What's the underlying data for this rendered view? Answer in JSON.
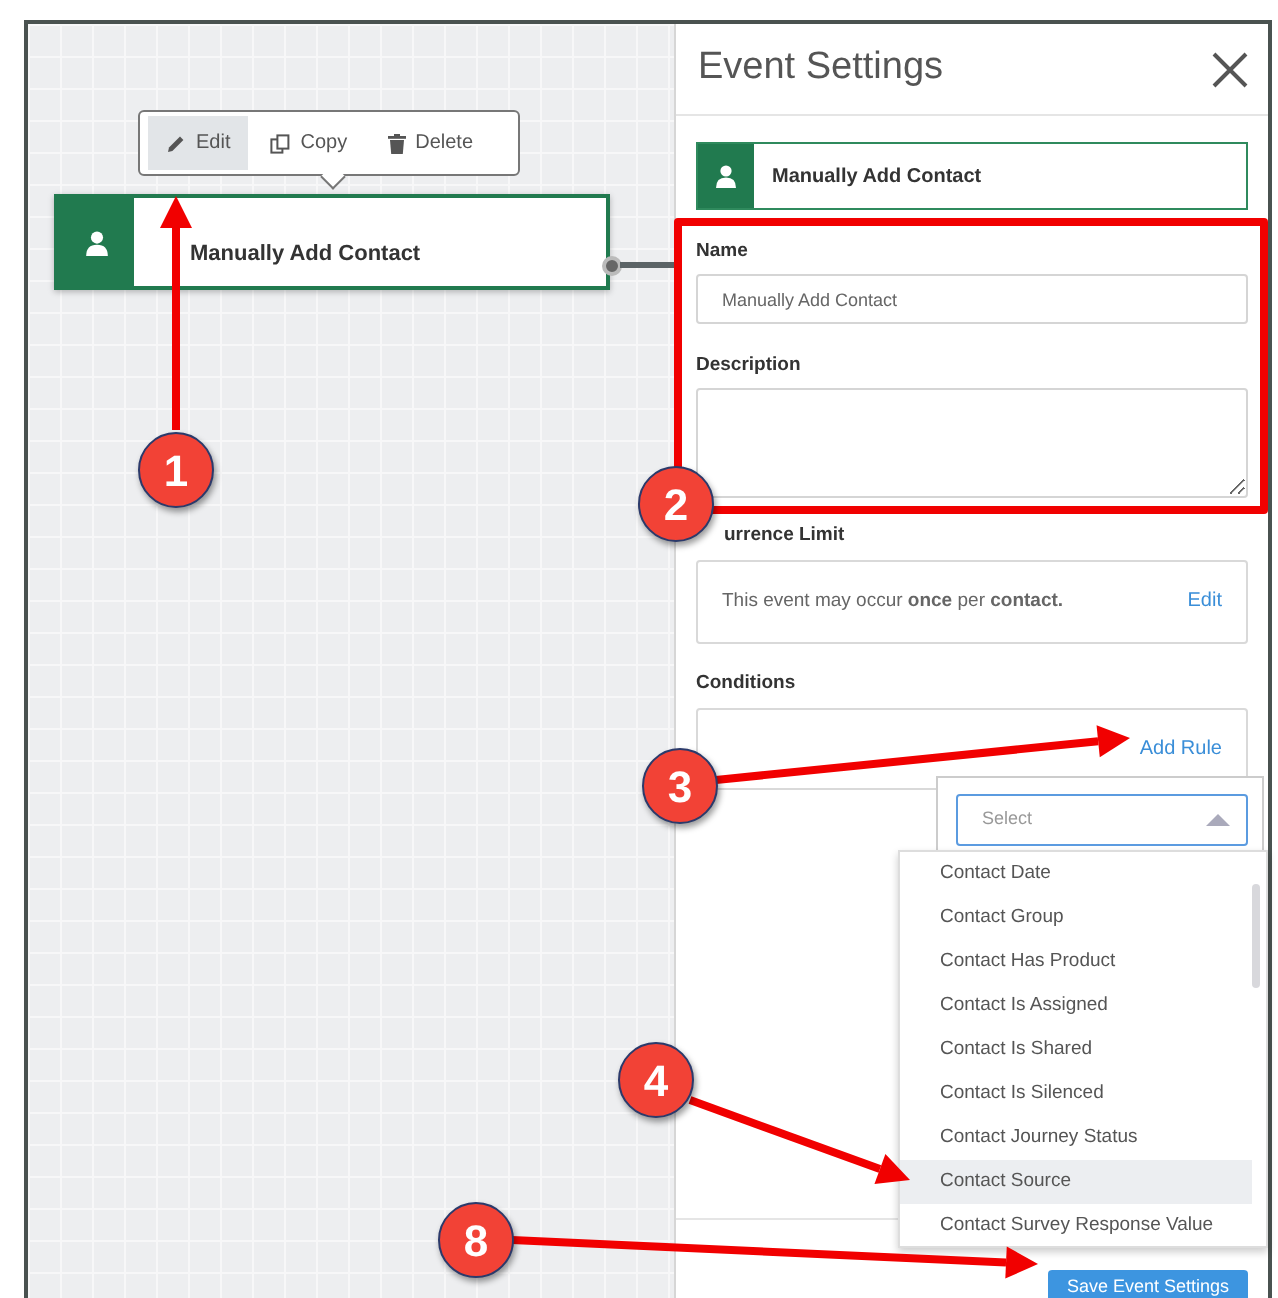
{
  "canvas": {
    "toolbar": [
      {
        "kind": "edit",
        "label": "Edit",
        "selected": true
      },
      {
        "kind": "copy",
        "label": "Copy",
        "selected": false
      },
      {
        "kind": "delete",
        "label": "Delete",
        "selected": false
      }
    ],
    "node": {
      "title": "Manually Add Contact"
    }
  },
  "panel": {
    "title": "Event Settings",
    "event": {
      "title": "Manually Add Contact"
    },
    "name": {
      "label": "Name",
      "value": "Manually Add Contact"
    },
    "description": {
      "label": "Description"
    },
    "occurrence": {
      "label": "urrence Limit",
      "text": "This event may occur **once** per **contact.**",
      "action": "Edit"
    },
    "conditions": {
      "label": "Conditions",
      "action": "Add Rule"
    },
    "rule_select": {
      "placeholder": "Select",
      "options": [
        {
          "label": "Contact Date",
          "selected": false
        },
        {
          "label": "Contact Group",
          "selected": false
        },
        {
          "label": "Contact Has Product",
          "selected": false
        },
        {
          "label": "Contact Is Assigned",
          "selected": false
        },
        {
          "label": "Contact Is Shared",
          "selected": false
        },
        {
          "label": "Contact Is Silenced",
          "selected": false
        },
        {
          "label": "Contact Journey Status",
          "selected": false
        },
        {
          "label": "Contact Source",
          "selected": true
        },
        {
          "label": "Contact Survey Response Value",
          "selected": false
        }
      ]
    },
    "save_button": "Save Event Settings"
  },
  "annotations": [
    {
      "number": "1"
    },
    {
      "number": "2"
    },
    {
      "number": "3"
    },
    {
      "number": "4"
    },
    {
      "number": "8"
    }
  ]
}
